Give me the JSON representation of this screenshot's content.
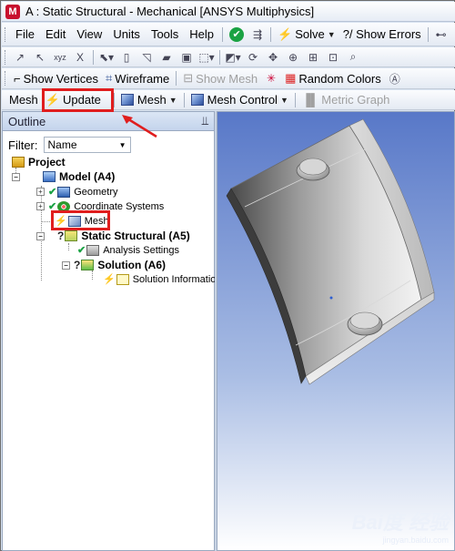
{
  "window": {
    "title": "A : Static Structural - Mechanical [ANSYS Multiphysics]",
    "app_logo": "M"
  },
  "menubar": {
    "items": [
      "File",
      "Edit",
      "View",
      "Units",
      "Tools",
      "Help"
    ],
    "solve_label": "Solve",
    "show_errors_label": "?/ Show Errors"
  },
  "toolbar2": {
    "x_label": "X"
  },
  "toolbar3": {
    "show_vertices": "Show Vertices",
    "wireframe": "Wireframe",
    "show_mesh": "Show Mesh",
    "random_colors": "Random Colors"
  },
  "context_toolbar": {
    "mesh_label": "Mesh",
    "update_label": "Update",
    "mesh_menu_label": "Mesh",
    "mesh_control_label": "Mesh Control",
    "metric_graph_label": "Metric Graph"
  },
  "outline": {
    "title": "Outline",
    "pin": "⫫",
    "filter_label": "Filter:",
    "filter_value": "Name",
    "tree": {
      "project": "Project",
      "model": "Model (A4)",
      "geometry": "Geometry",
      "coordinate_systems": "Coordinate Systems",
      "mesh": "Mesh",
      "static_structural": "Static Structural (A5)",
      "analysis_settings": "Analysis Settings",
      "solution": "Solution (A6)",
      "solution_information": "Solution Informatio"
    }
  },
  "watermark": {
    "brand": "Bai度 经验",
    "sub": "jingyan.baidu.com"
  },
  "colors": {
    "highlight": "#e01e1e",
    "viewport_top": "#5878c8",
    "viewport_bottom": "#ffffff"
  }
}
